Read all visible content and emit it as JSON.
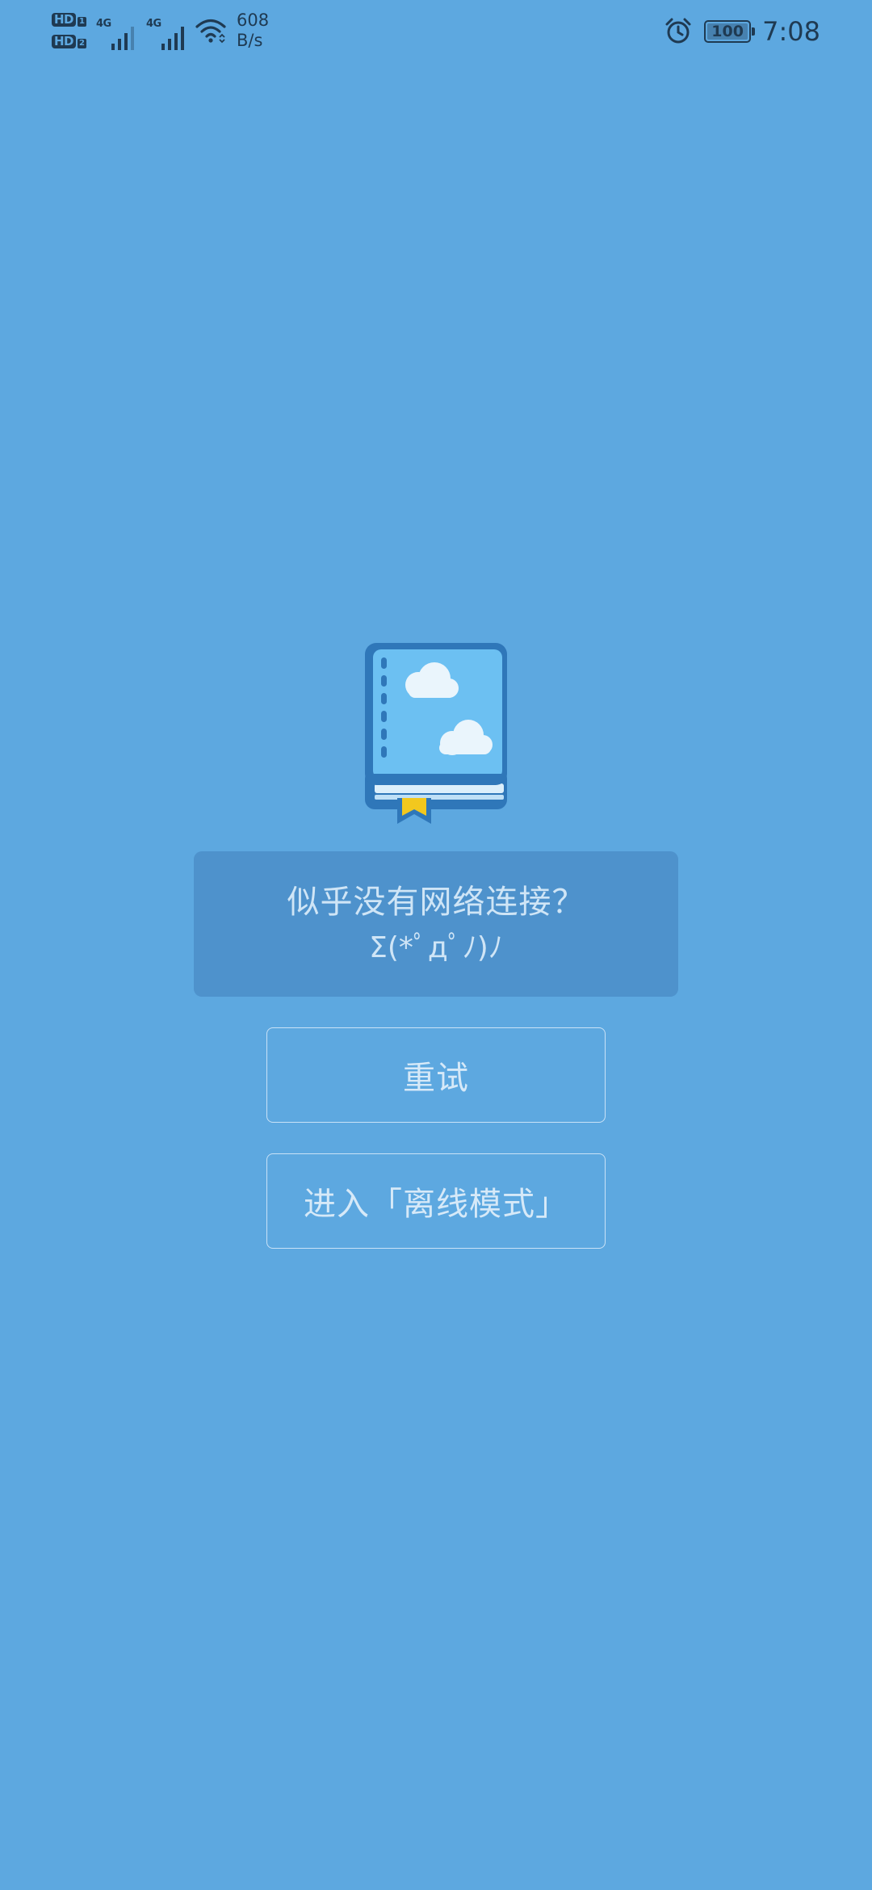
{
  "status_bar": {
    "hd1_label": "HD",
    "hd1_sub": "1",
    "hd2_label": "HD",
    "hd2_sub": "2",
    "sim1_network": "4G",
    "sim2_network": "4G",
    "net_speed_value": "608",
    "net_speed_unit": "B/s",
    "battery_level": "100",
    "time": "7:08",
    "icons": [
      "hd-icon",
      "signal-icon",
      "wifi-icon",
      "alarm-icon",
      "battery-icon"
    ]
  },
  "illustration": {
    "icon": "book-icon",
    "colors": {
      "cover": "#6CC0F2",
      "border": "#2F77B9",
      "pages": "#DCEFFB",
      "bookmark": "#F2C81E",
      "clouds": "#EAF5FC"
    }
  },
  "message": {
    "title": "似乎没有网络连接？",
    "kaomoji": "Σ(*ﾟдﾟﾉ)ﾉ"
  },
  "buttons": {
    "retry_label": "重试",
    "offline_label": "进入「离线模式」"
  },
  "colors": {
    "background": "#5DA8E0",
    "message_box": "#4F90C8",
    "text": "#CFE5F6",
    "status_text": "#1F3A52"
  }
}
